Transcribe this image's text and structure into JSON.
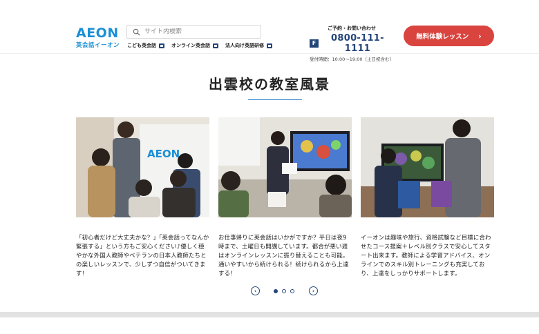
{
  "header": {
    "logo_word": "AEON",
    "logo_sub": "英会話イーオン",
    "search_placeholder": "サイト内検索",
    "sublinks": [
      "こども英会話",
      "オンライン英会話",
      "法人向け英語研修"
    ],
    "contact_label": "ご予約・お問い合わせ",
    "freedial_mark": "F",
    "phone": "0800-111-1111",
    "hours": "受付時間：10:00～19:00（土日祝含む）",
    "cta_label": "無料体験レッスン",
    "cta_chevron": "›"
  },
  "section": {
    "title": "出雲校の教室風景"
  },
  "cards": [
    {
      "photo_sign": "AEON",
      "caption": "「初心者だけど大丈夫かな？」「英会話ってなんか緊張する」という方もご安心ください♪優しく穏やかな外国人教師やベテランの日本人教師たちとの楽しいレッスンで、少しずつ自信がついてきます！"
    },
    {
      "caption": "お仕事帰りに英会話はいかがですか？平日は夜9時まで、土曜日も開講しています。都合が悪い週はオンラインレッスンに振り替えることも可能。通いやすいから続けられる！続けられるから上達する！"
    },
    {
      "caption": "イーオンは趣味や旅行、資格試験など目標に合わせたコース提案＋レベル別クラスで安心してスタート出来ます。教師による学習アドバイス、オンラインでのスキル別トレーニングも充実しており、上達をしっかりサポートします。"
    }
  ],
  "carousel": {
    "prev_icon": "chevron-left-icon",
    "next_icon": "chevron-right-icon",
    "prev_glyph": "‹",
    "next_glyph": "›",
    "slide_count": 3,
    "active_index": 0
  },
  "colors": {
    "brand_blue": "#1b8fd6",
    "navy": "#24457a",
    "cta_red": "#d9443e",
    "rule_blue": "#3f8bcf"
  }
}
